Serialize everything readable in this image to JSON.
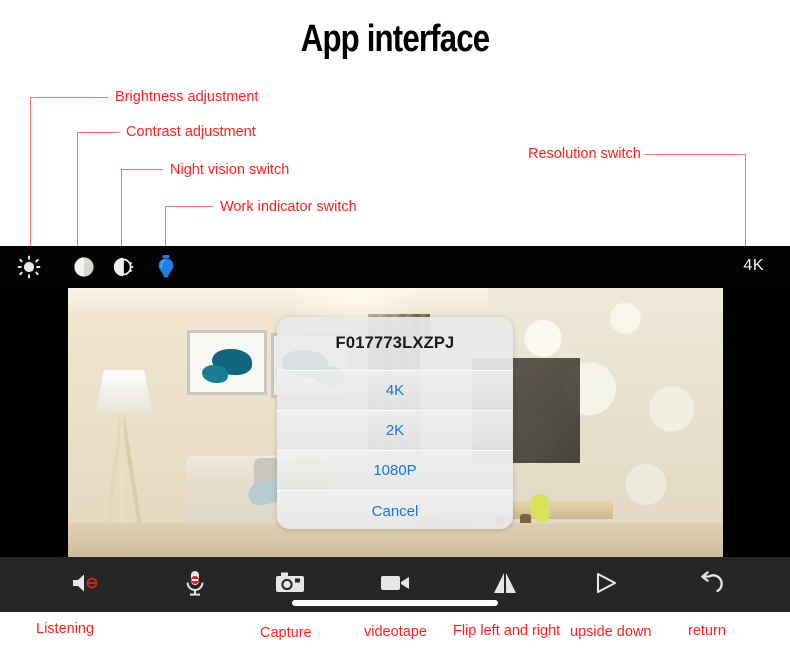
{
  "page": {
    "title": "App interface",
    "watermark": "",
    "accent_red": "#ff1f1f",
    "leader_red": "#f2707a",
    "dialog_blue": "#1577e0"
  },
  "callouts": [
    {
      "label": "Brightness adjustment",
      "target": "brightness-icon"
    },
    {
      "label": "Contrast adjustment",
      "target": "contrast-icon"
    },
    {
      "label": "Night vision switch",
      "target": "night-vision-icon"
    },
    {
      "label": "Work indicator switch",
      "target": "work-indicator-icon"
    },
    {
      "label": "Resolution switch",
      "target": "resolution-button"
    }
  ],
  "top_toolbar": {
    "icons": [
      {
        "name": "brightness-icon",
        "glyph": "sun"
      },
      {
        "name": "contrast-icon",
        "glyph": "half-circle"
      },
      {
        "name": "night-vision-icon",
        "glyph": "moon-rays"
      },
      {
        "name": "work-indicator-icon",
        "glyph": "light-bulb",
        "color": "#1e7fe0"
      }
    ],
    "resolution_label": "4K"
  },
  "dialog": {
    "title": "F017773LXZPJ",
    "options": [
      {
        "label": "4K"
      },
      {
        "label": "2K"
      },
      {
        "label": "1080P"
      }
    ],
    "cancel": "Cancel"
  },
  "bottom_toolbar": {
    "buttons": [
      {
        "name": "listen-button",
        "glyph": "speaker-muted",
        "caption": "Listening"
      },
      {
        "name": "talk-button",
        "glyph": "microphone-muted",
        "caption": ""
      },
      {
        "name": "capture-button",
        "glyph": "camera",
        "caption": "Capture"
      },
      {
        "name": "record-button",
        "glyph": "video-camera",
        "caption": "videotape"
      },
      {
        "name": "flip-h-button",
        "glyph": "mirror-triangles",
        "caption": "Flip left and right"
      },
      {
        "name": "flip-v-button",
        "glyph": "triangle-outline",
        "caption": "upside down"
      },
      {
        "name": "return-button",
        "glyph": "undo-arrow",
        "caption": "return"
      }
    ]
  }
}
